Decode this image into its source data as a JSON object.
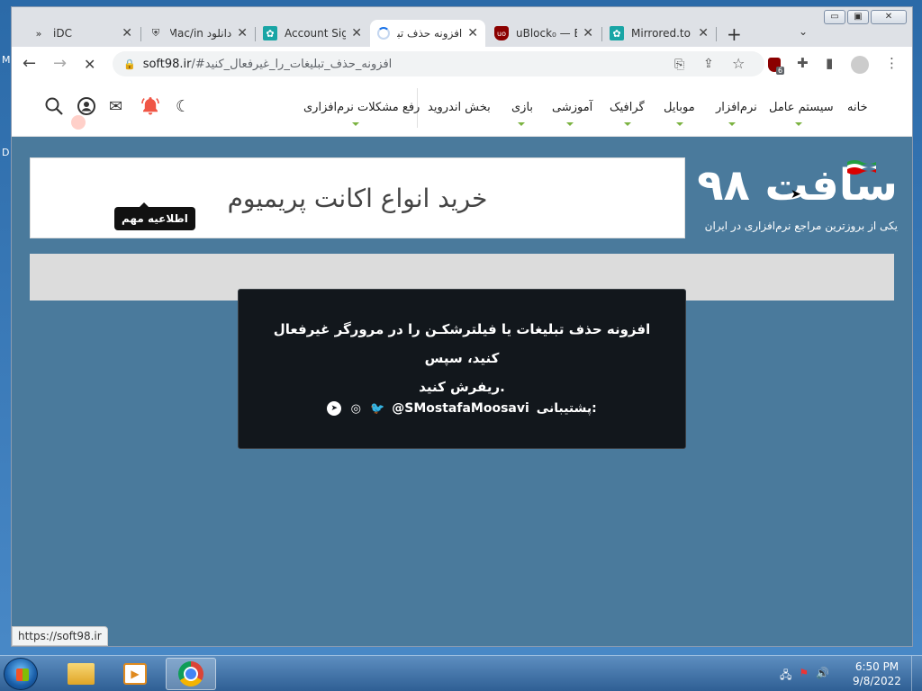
{
  "desktop": {
    "edge_letters": [
      "M",
      "D"
    ]
  },
  "browser": {
    "tabs": [
      {
        "title": "iDC",
        "favicon": "double-chevron-icon"
      },
      {
        "title": "دانلود Mac/in",
        "favicon": "site-icon"
      },
      {
        "title": "Account Sig",
        "favicon": "gear-favicon"
      },
      {
        "title": "افزونه حذف تبلی",
        "favicon": "loading-spinner",
        "active": true
      },
      {
        "title": "uBlock₀ — E",
        "favicon": "ublock-icon"
      },
      {
        "title": "Mirrored.to",
        "favicon": "gear-favicon"
      }
    ],
    "tab_close_glyph": "✕",
    "new_tab_glyph": "+",
    "tab_dropdown_glyph": "⌄",
    "window_controls": {
      "minimize": "▭",
      "maximize": "▣",
      "close": "✕"
    },
    "nav": {
      "back": "←",
      "forward": "→",
      "reload": "✕"
    },
    "address": {
      "host": "soft98.ir",
      "path": "/#افزونه_حذف_تبلیغات_را_غیرفعال_کنید"
    },
    "extension_badge_count": "6",
    "status_url": "https://soft98.ir"
  },
  "site": {
    "menu": [
      {
        "label": "خانه",
        "has_submenu": false
      },
      {
        "label": "سیستم عامل",
        "has_submenu": true
      },
      {
        "label": "نرم‌افزار",
        "has_submenu": true
      },
      {
        "label": "موبایل",
        "has_submenu": true
      },
      {
        "label": "گرافیک",
        "has_submenu": true
      },
      {
        "label": "آموزشی",
        "has_submenu": true
      },
      {
        "label": "بازی",
        "has_submenu": true
      },
      {
        "label": "بخش اندروید",
        "has_submenu": false
      },
      {
        "label": "رفع مشکلات نرم‌افزاری",
        "has_submenu": true
      }
    ],
    "icons": [
      "moon-icon",
      "bell-icon",
      "mail-icon",
      "user-icon",
      "search-icon"
    ],
    "tooltip": "اطلاعیه مهم",
    "banner_text": "خرید انواع اکانت پریمیوم",
    "logo_text": "سافت ۹۸",
    "tagline": "یکی از بروزترین مراجع نرم‌افزاری در ایران",
    "accent_color": "#7cb342",
    "bell_color": "#f05545"
  },
  "modal": {
    "message_line1": "افزونه حذف تبلیغات یا فیلترشکـن را در مرورگر غیرفعال کنید، سپس",
    "message_line2": "ریفرش کنید.",
    "support_label": "پشتیبانی:",
    "support_handle": "@SMostafaMoosavi",
    "social_icons": [
      "twitter-icon",
      "instagram-icon",
      "telegram-icon"
    ]
  },
  "taskbar": {
    "items": [
      "start-button",
      "file-explorer",
      "media-player",
      "chrome"
    ],
    "time": "6:50 PM",
    "date": "9/8/2022"
  }
}
